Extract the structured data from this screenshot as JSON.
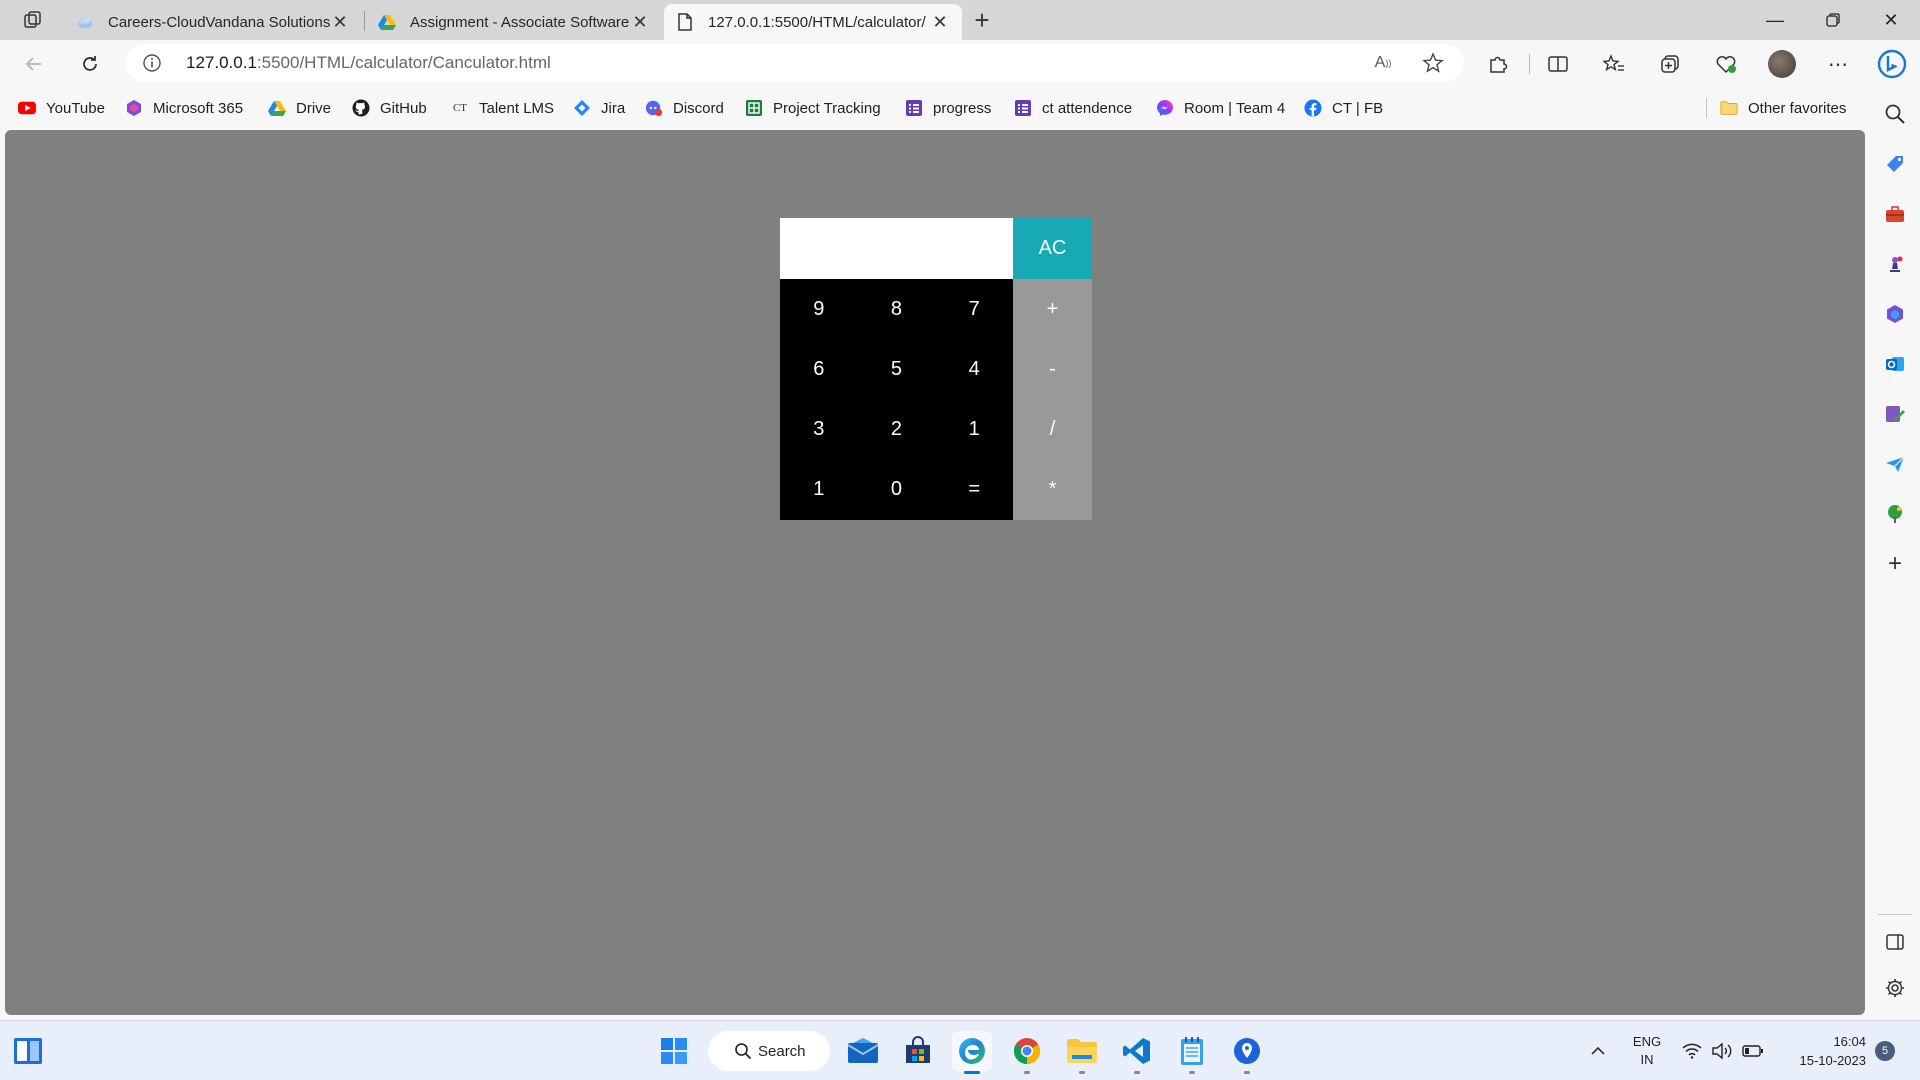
{
  "browser": {
    "tabs": [
      {
        "title": "Careers-CloudVandana Solutions",
        "active": false
      },
      {
        "title": "Assignment - Associate Software",
        "active": false
      },
      {
        "title": "127.0.0.1:5500/HTML/calculator/",
        "active": true
      }
    ],
    "address": {
      "host": "127.0.0.1",
      "path": ":5500/HTML/calculator/Canculator.html"
    },
    "bookmarks": [
      {
        "label": "YouTube",
        "icon": "youtube-icon"
      },
      {
        "label": "Microsoft 365",
        "icon": "microsoft365-icon"
      },
      {
        "label": "Drive",
        "icon": "drive-icon"
      },
      {
        "label": "GitHub",
        "icon": "github-icon"
      },
      {
        "label": "Talent LMS",
        "icon": "talentlms-icon"
      },
      {
        "label": "Jira",
        "icon": "jira-icon"
      },
      {
        "label": "Discord",
        "icon": "discord-icon"
      },
      {
        "label": "Project Tracking",
        "icon": "sheets-icon"
      },
      {
        "label": "progress",
        "icon": "forms-icon"
      },
      {
        "label": "ct attendence",
        "icon": "forms-icon"
      },
      {
        "label": "Room | Team 4",
        "icon": "messenger-icon"
      },
      {
        "label": "CT | FB",
        "icon": "facebook-icon"
      }
    ],
    "other_favorites": "Other favorites"
  },
  "calculator": {
    "display": "",
    "clear_label": "AC",
    "keys": [
      "9",
      "8",
      "7",
      "6",
      "5",
      "4",
      "3",
      "2",
      "1",
      "1",
      "0",
      "="
    ],
    "operators": [
      "+",
      "-",
      "/",
      "*"
    ]
  },
  "taskbar": {
    "search_label": "Search",
    "lang_top": "ENG",
    "lang_bottom": "IN",
    "time": "16:04",
    "date": "15-10-2023",
    "notification_count": "5"
  },
  "colors": {
    "page_background": "#808080",
    "ac_button": "#17aab5",
    "operator_column": "#999999",
    "keypad": "#000000"
  }
}
